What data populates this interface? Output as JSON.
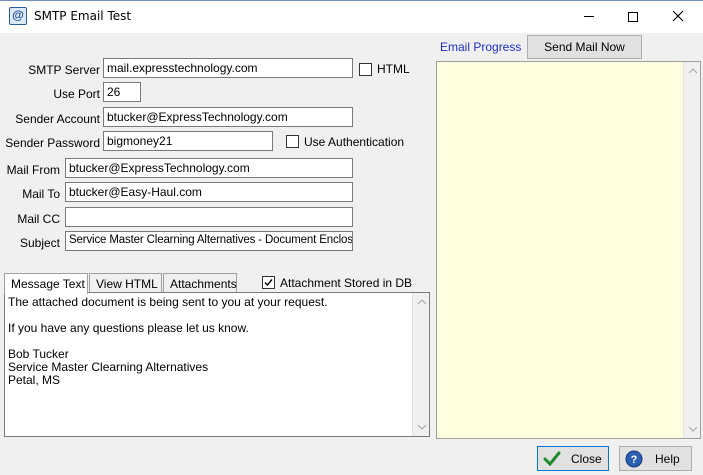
{
  "window": {
    "title": "SMTP Email Test",
    "app_icon_glyph": "@",
    "minimize_icon": "minimize-icon",
    "maximize_icon": "maximize-icon",
    "close_icon": "close-icon"
  },
  "form": {
    "smtp_server": {
      "label": "SMTP Server",
      "value": "mail.expresstechnology.com"
    },
    "html_checkbox": {
      "label": "HTML",
      "checked": false
    },
    "use_port": {
      "label": "Use Port",
      "value": "26"
    },
    "sender_account": {
      "label": "Sender Account",
      "value": "btucker@ExpressTechnology.com"
    },
    "sender_password": {
      "label": "Sender Password",
      "value": "bigmoney21"
    },
    "use_authentication": {
      "label": "Use Authentication",
      "checked": false
    },
    "mail_from": {
      "label": "Mail From",
      "value": "btucker@ExpressTechnology.com"
    },
    "mail_to": {
      "label": "Mail To",
      "value": "btucker@Easy-Haul.com"
    },
    "mail_cc": {
      "label": "Mail CC",
      "value": ""
    },
    "subject": {
      "label": "Subject",
      "value": "Service Master Clearning Alternatives - Document Enclosed"
    }
  },
  "tabs": [
    {
      "label": "Message Text",
      "active": true
    },
    {
      "label": "View HTML",
      "active": false
    },
    {
      "label": "Attachments",
      "active": false
    }
  ],
  "attachment_stored": {
    "label": "Attachment Stored in DB",
    "checked": true
  },
  "message_text": "The attached document is being sent to you at your request.\n\nIf you have any questions please let us know.\n\nBob Tucker\nService Master Clearning Alternatives\nPetal, MS",
  "progress": {
    "label": "Email Progress",
    "send_button": "Send Mail Now",
    "log": ""
  },
  "buttons": {
    "close": "Close",
    "help": "Help"
  },
  "colors": {
    "progress_background": "#ffffe0",
    "progress_label": "#1a2ecb",
    "accent": "#0078d7"
  }
}
